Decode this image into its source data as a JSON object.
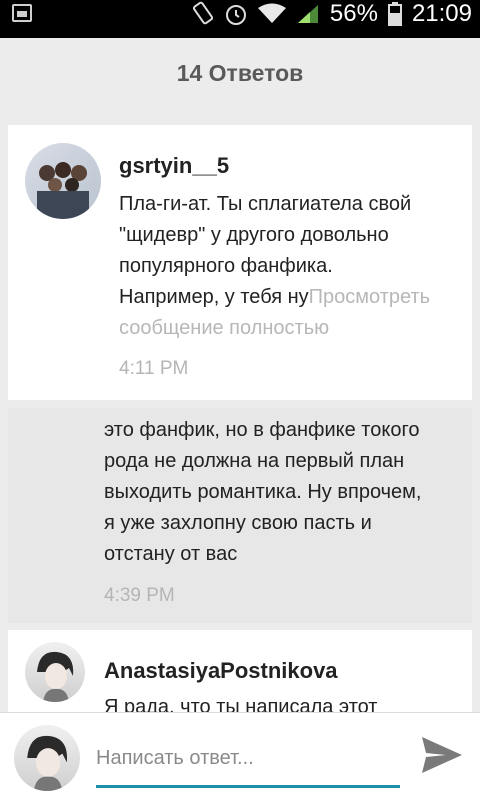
{
  "status_bar": {
    "battery_percent": "56%",
    "time": "21:09",
    "icons": [
      "image-icon",
      "battery-saver-icon",
      "alarm-icon",
      "wifi-icon",
      "signal-icon",
      "battery-icon"
    ]
  },
  "header": {
    "title": "14 Ответов"
  },
  "comments": [
    {
      "username": "gsrtyin__5",
      "message_lines": [
        "Пла-ги-ат.  Ты сплагиатела свой",
        "\"щидевр\" у другого довольно",
        "популярного фанфика.",
        "Например, у тебя ну"
      ],
      "view_more_inline": "Просмотреть",
      "view_more_line2": "сообщение полностью",
      "time": "4:11 PM"
    },
    {
      "message_lines": [
        "это фанфик,  но в фанфике токого",
        "рода не должна на первый план",
        "выходить романтика. Ну впрочем,",
        "я уже захлопну свою пасть и",
        "отстану от вас"
      ],
      "time": "4:39 PM"
    },
    {
      "username": "AnastasiyaPostnikova",
      "message_preview": "Я рада, что ты написала этот"
    }
  ],
  "reply": {
    "placeholder": "Написать ответ..."
  },
  "colors": {
    "accent": "#1e8fa8",
    "card_bg": "#ffffff",
    "alt_bg": "#e7e7e7",
    "page_bg": "#ececec"
  }
}
